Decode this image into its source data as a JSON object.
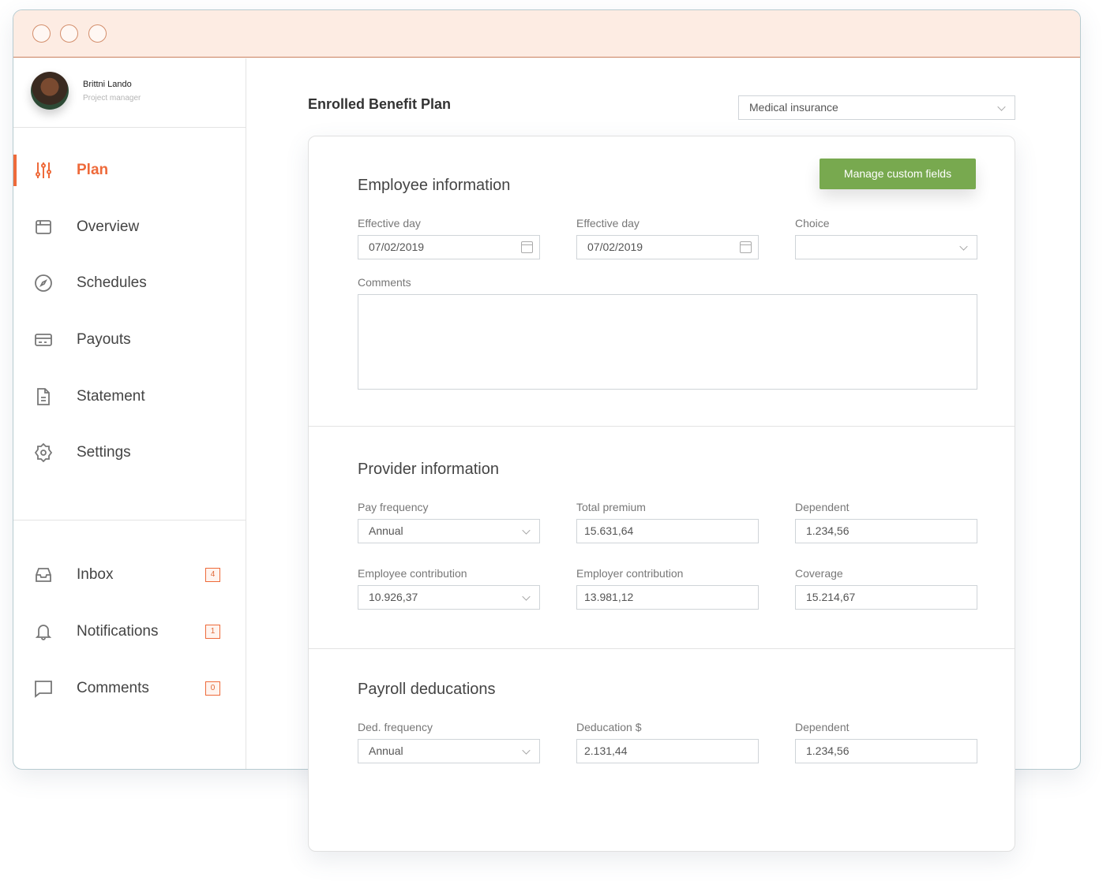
{
  "user": {
    "name": "Brittni Lando",
    "role": "Project manager"
  },
  "nav": [
    {
      "label": "Plan",
      "icon": "sliders-icon"
    },
    {
      "label": "Overview",
      "icon": "calendar-window-icon"
    },
    {
      "label": "Schedules",
      "icon": "compass-icon"
    },
    {
      "label": "Payouts",
      "icon": "credit-card-icon"
    },
    {
      "label": "Statement",
      "icon": "document-icon"
    },
    {
      "label": "Settings",
      "icon": "gear-icon"
    }
  ],
  "nav2": [
    {
      "label": "Inbox",
      "badge": "4",
      "icon": "inbox-icon"
    },
    {
      "label": "Notifications",
      "badge": "1",
      "icon": "bell-icon"
    },
    {
      "label": "Comments",
      "badge": "0",
      "icon": "chat-icon"
    }
  ],
  "page": {
    "title": "Enrolled Benefit Plan",
    "plan_select": "Medical insurance"
  },
  "employee": {
    "heading": "Employee information",
    "button": "Manage custom fields",
    "fields": [
      {
        "label": "Effective day",
        "value": "07/02/2019"
      },
      {
        "label": "Effective day",
        "value": "07/02/2019"
      },
      {
        "label": "Choice",
        "value": ""
      }
    ],
    "comments_label": "Comments",
    "comments_value": ""
  },
  "provider": {
    "heading": "Provider information",
    "fields": [
      {
        "label": "Pay frequency",
        "value": "Annual"
      },
      {
        "label": "Total premium",
        "value": "15.631,64"
      },
      {
        "label": "Dependent",
        "value": "1.234,56"
      },
      {
        "label": "Employee contribution",
        "value": "10.926,37"
      },
      {
        "label": "Employer contribution",
        "value": "13.981,12"
      },
      {
        "label": "Coverage",
        "value": "15.214,67"
      }
    ]
  },
  "payroll": {
    "heading": "Payroll deducations",
    "fields": [
      {
        "label": "Ded. frequency",
        "value": "Annual"
      },
      {
        "label": "Deducation $",
        "value": "2.131,44"
      },
      {
        "label": "Dependent",
        "value": "1.234,56"
      }
    ]
  },
  "colors": {
    "accent": "#ee6a3a",
    "green": "#78a94f",
    "titlebar": "#fdece3"
  }
}
